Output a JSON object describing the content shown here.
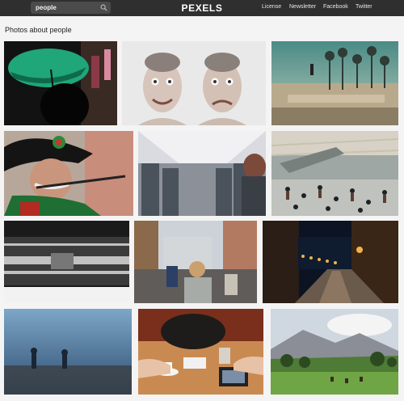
{
  "header": {
    "search_value": "people",
    "logo": "PEXELS",
    "nav": [
      "License",
      "Newsletter",
      "Facebook",
      "Twitter"
    ]
  },
  "page": {
    "heading": "Photos about people"
  },
  "photos": [
    {
      "subject": "green umbrella street"
    },
    {
      "subject": "two faces expressions"
    },
    {
      "subject": "skatepark palm trees"
    },
    {
      "subject": "musician in uniform"
    },
    {
      "subject": "airplane cabin"
    },
    {
      "subject": "busy station crowd"
    },
    {
      "subject": "blurred train motion"
    },
    {
      "subject": "city street scooters"
    },
    {
      "subject": "night street lights"
    },
    {
      "subject": "foggy field people"
    },
    {
      "subject": "cafe table hands"
    },
    {
      "subject": "mountain meadow"
    }
  ],
  "colors": {
    "topbar": "#2f2f2f",
    "search_bg": "#4b4b4b",
    "page_bg": "#f4f4f4"
  }
}
